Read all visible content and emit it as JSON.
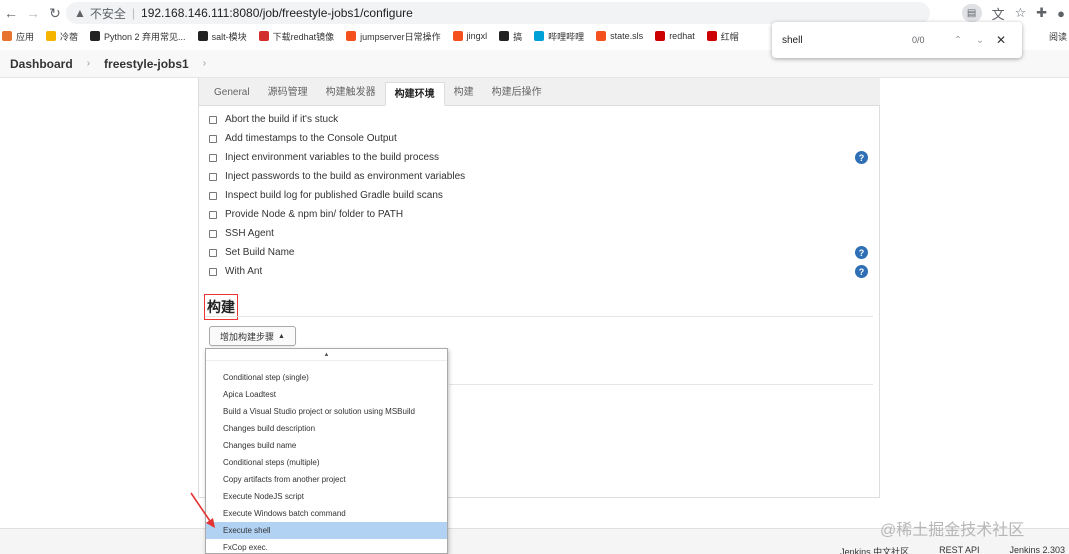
{
  "browser": {
    "insecure_label": "不安全",
    "url": "192.168.146.111:8080/job/freestyle-jobs1/configure",
    "bookmarks": [
      {
        "label": "应用",
        "color": "#e6732e"
      },
      {
        "label": "冷蓿",
        "color": "#f4b400"
      },
      {
        "label": "Python 2 弃用常见...",
        "color": "#222222"
      },
      {
        "label": "salt-模块",
        "color": "#222222"
      },
      {
        "label": "下载redhat镜像",
        "color": "#d32f2f"
      },
      {
        "label": "jumpserver日常操作",
        "color": "#f4511e"
      },
      {
        "label": "jingxl",
        "color": "#f4511e"
      },
      {
        "label": "搞",
        "color": "#222222"
      },
      {
        "label": "哔哩哔哩",
        "color": "#00a1d6"
      },
      {
        "label": "state.sls",
        "color": "#f4511e"
      },
      {
        "label": "redhat",
        "color": "#cc0000"
      },
      {
        "label": "红帽",
        "color": "#cc0000"
      }
    ],
    "reading_list": "阅读"
  },
  "findbar": {
    "query": "shell",
    "count": "0/0"
  },
  "breadcrumb": {
    "root": "Dashboard",
    "job": "freestyle-jobs1"
  },
  "tabs": [
    {
      "label": "General",
      "active": false
    },
    {
      "label": "源码管理",
      "active": false
    },
    {
      "label": "构建触发器",
      "active": false
    },
    {
      "label": "构建环境",
      "active": true
    },
    {
      "label": "构建",
      "active": false
    },
    {
      "label": "构建后操作",
      "active": false
    }
  ],
  "build_env_options": [
    {
      "label": "Abort the build if it's stuck",
      "help": false
    },
    {
      "label": "Add timestamps to the Console Output",
      "help": false
    },
    {
      "label": "Inject environment variables to the build process",
      "help": true
    },
    {
      "label": "Inject passwords to the build as environment variables",
      "help": false
    },
    {
      "label": "Inspect build log for published Gradle build scans",
      "help": false
    },
    {
      "label": "Provide Node & npm bin/ folder to PATH",
      "help": false
    },
    {
      "label": "SSH Agent",
      "help": false
    },
    {
      "label": "Set Build Name",
      "help": true
    },
    {
      "label": "With Ant",
      "help": true
    }
  ],
  "build_section": {
    "title": "构建",
    "add_step_label": "增加构建步骤"
  },
  "step_menu": [
    "Conditional step (single)",
    "Apica Loadtest",
    "Build a Visual Studio project or solution using MSBuild",
    "Changes build description",
    "Changes build name",
    "Conditional steps (multiple)",
    "Copy artifacts from another project",
    "Execute NodeJS script",
    "Execute Windows batch command",
    "Execute shell",
    "FxCop exec."
  ],
  "step_menu_selected": "Execute shell",
  "footer": {
    "community": "Jenkins 中文社区",
    "rest_api": "REST API",
    "version": "Jenkins 2.303"
  },
  "watermark": "@稀土掘金技术社区",
  "colors": {
    "accent_red": "#e33333",
    "help_blue": "#2e6fb5",
    "selected_bg": "#b2d2f3"
  }
}
